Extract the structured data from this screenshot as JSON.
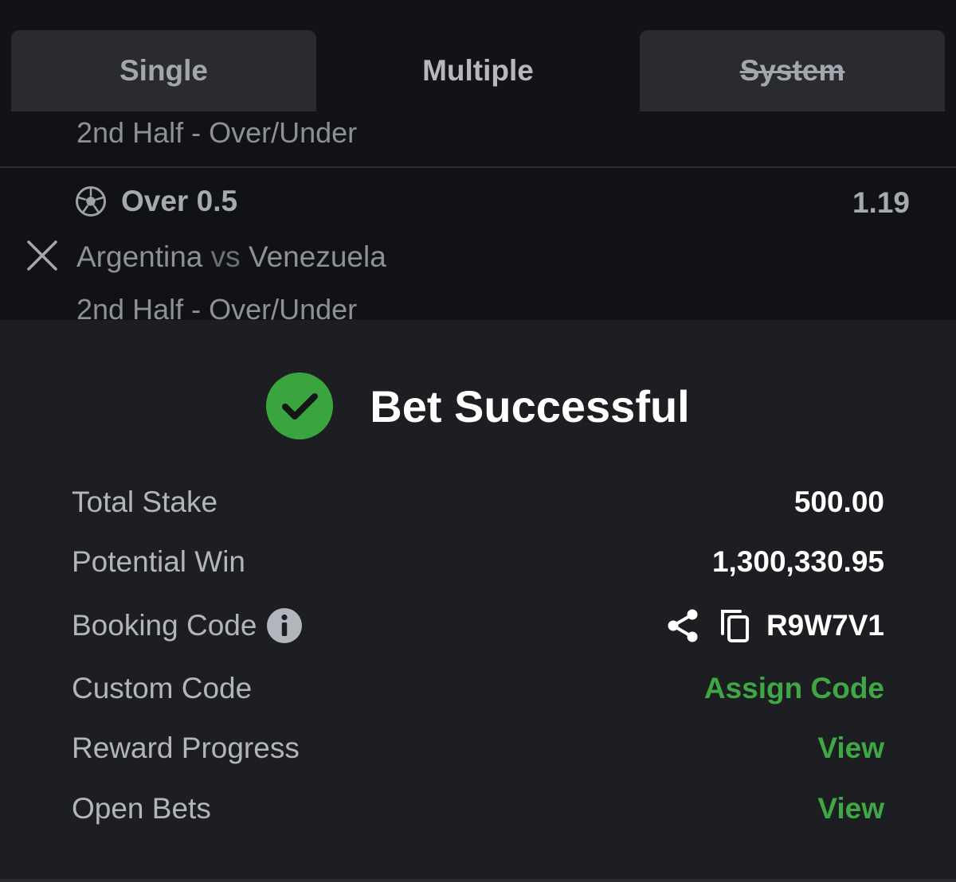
{
  "tabs": [
    {
      "label": "Single"
    },
    {
      "label": "Multiple"
    },
    {
      "label": "System"
    }
  ],
  "bet_list": {
    "prev_market": "2nd Half - Over/Under",
    "selection": {
      "name": "Over 0.5",
      "odds": "1.19",
      "home": "Argentina",
      "vs": "vs",
      "away": "Venezuela",
      "market": "2nd Half - Over/Under",
      "sport_icon": "soccer-ball-icon",
      "remove_icon": "close-icon"
    }
  },
  "success": {
    "title": "Bet Successful",
    "icon": "check-circle-icon",
    "icon_color": "#3aa53f"
  },
  "summary": {
    "total_stake": {
      "label": "Total Stake",
      "value": "500.00"
    },
    "potential_win": {
      "label": "Potential Win",
      "value": "1,300,330.95"
    },
    "booking_code": {
      "label": "Booking Code",
      "value": "R9W7V1"
    },
    "custom_code": {
      "label": "Custom Code",
      "action": "Assign Code"
    },
    "reward_progress": {
      "label": "Reward Progress",
      "action": "View"
    },
    "open_bets": {
      "label": "Open Bets",
      "action": "View"
    }
  },
  "colors": {
    "accent_green": "#3fa744",
    "panel_bg": "#1d1e22",
    "page_bg": "#151619"
  }
}
